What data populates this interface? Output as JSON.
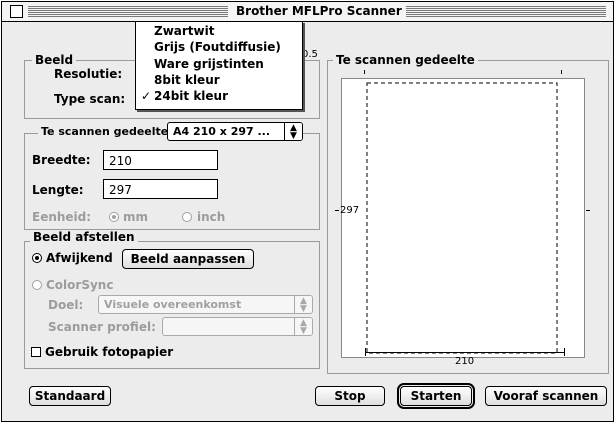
{
  "window": {
    "title": "Brother MFLPro Scanner"
  },
  "scan_type_menu": {
    "items": [
      {
        "label": "Zwartwit",
        "checked": false
      },
      {
        "label": "Grijs (Foutdiffusie)",
        "checked": false
      },
      {
        "label": "Ware grijstinten",
        "checked": false
      },
      {
        "label": "8bit kleur",
        "checked": false
      },
      {
        "label": "24bit kleur",
        "checked": true
      }
    ],
    "check_mark": "✓"
  },
  "beeld": {
    "label": "Beeld",
    "resolution_label": "Resolutie:",
    "type_scan_label": "Type scan:",
    "partial_value": "0.5"
  },
  "area": {
    "label": "Te scannen gedeelte",
    "size_value": "A4 210 x 297 ...",
    "width_label": "Breedte:",
    "width_value": "210",
    "length_label": "Lengte:",
    "length_value": "297",
    "unit_label": "Eenheid:",
    "unit_mm": "mm",
    "unit_inch": "inch",
    "unit_selected": "mm"
  },
  "adjust": {
    "label": "Beeld afstellen",
    "custom_label": "Afwijkend",
    "adjust_button": "Beeld aanpassen",
    "colorsync_label": "ColorSync",
    "target_label": "Doel:",
    "target_value": "Visuele overeenkomst",
    "profile_label": "Scanner profiel:",
    "profile_value": "",
    "photo_paper_label": "Gebruik fotopapier",
    "photo_paper_checked": false
  },
  "preview": {
    "label": "Te scannen gedeelte",
    "height_value": "297",
    "width_value": "210"
  },
  "buttons": {
    "default": "Standaard",
    "stop": "Stop",
    "start": "Starten",
    "prescan": "Vooraf scannen"
  }
}
